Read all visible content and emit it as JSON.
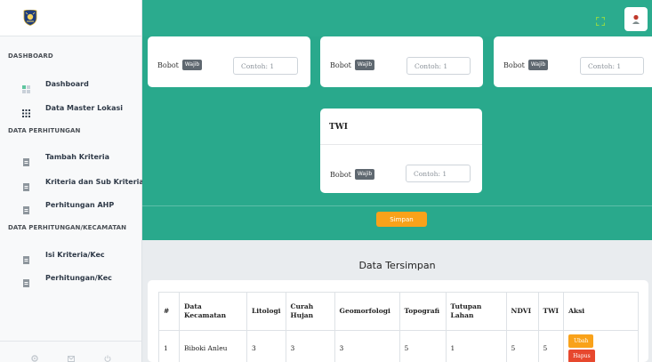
{
  "sidebar": {
    "sections": [
      {
        "heading": "DASHBOARD",
        "items": [
          {
            "label": "Dashboard",
            "icon": "dashboard-icon"
          },
          {
            "label": "Data Master Lokasi",
            "icon": "grid-icon"
          }
        ]
      },
      {
        "heading": "DATA PERHITUNGAN",
        "items": [
          {
            "label": "Tambah Kriteria",
            "icon": "document-icon"
          },
          {
            "label": "Kriteria dan Sub Kriteria",
            "icon": "document-icon"
          },
          {
            "label": "Perhitungan AHP",
            "icon": "document-icon"
          }
        ]
      },
      {
        "heading": "DATA PERHITUNGAN/KECAMATAN",
        "items": [
          {
            "label": "Isi Kriteria/Kec",
            "icon": "document-icon"
          },
          {
            "label": "Perhitungan/Kec",
            "icon": "document-icon"
          }
        ]
      }
    ],
    "footer_icons": [
      "gear-icon",
      "mail-icon",
      "power-icon"
    ]
  },
  "form": {
    "bobot_label": "Bobot",
    "badge": "Wajib",
    "placeholder": "Contoh: 1",
    "twi_title": "TWI",
    "save_label": "Simpan"
  },
  "table": {
    "title": "Data Tersimpan",
    "headers": [
      "#",
      "Data Kecamatan",
      "Litologi",
      "Curah Hujan",
      "Geomorfologi",
      "Topografi",
      "Tutupan Lahan",
      "NDVI",
      "TWI",
      "Aksi"
    ],
    "rows": [
      {
        "no": "1",
        "kecamatan": "Biboki Anleu",
        "litologi": "3",
        "curah_hujan": "3",
        "geomorfologi": "3",
        "topografi": "5",
        "tutupan_lahan": "1",
        "ndvi": "5",
        "twi": "5"
      }
    ],
    "edit_label": "Ubah",
    "delete_label": "Hapus"
  },
  "colors": {
    "teal": "#2bab8e",
    "orange": "#f9a21a",
    "red": "#e7482e"
  }
}
